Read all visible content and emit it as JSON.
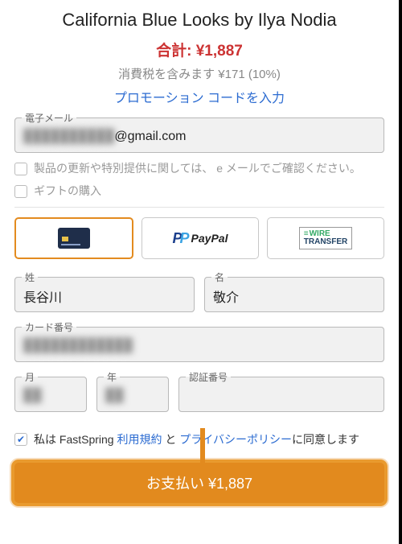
{
  "title": "California Blue Looks by Ilya Nodia",
  "total": {
    "label": "合計:",
    "amount": "¥1,887"
  },
  "tax_line": "消費税を含みます ¥171 (10%)",
  "promo_link": "プロモーション コードを入力",
  "email": {
    "legend": "電子メール",
    "value_masked": "██████████",
    "value_tail": "@gmail.com"
  },
  "opt_updates": {
    "label": "製品の更新や特別提供に関しては、 e メールでご確認ください。",
    "checked": false
  },
  "opt_gift": {
    "label": "ギフトの購入",
    "checked": false
  },
  "payment_methods": {
    "card": {
      "name": "credit-card",
      "selected": true
    },
    "paypal": {
      "label": "PayPal",
      "selected": false
    },
    "wire": {
      "label_top": "WIRE",
      "label_bottom": "TRANSFER",
      "selected": false
    }
  },
  "name": {
    "last": {
      "legend": "姓",
      "value": "長谷川"
    },
    "first": {
      "legend": "名",
      "value": "敬介"
    }
  },
  "card": {
    "number": {
      "legend": "カード番号",
      "value_masked": "████████████"
    },
    "month": {
      "legend": "月",
      "value_masked": "██"
    },
    "year": {
      "legend": "年",
      "value_masked": "██"
    },
    "cvv": {
      "legend": "認証番号",
      "value": ""
    }
  },
  "terms": {
    "checked": true,
    "prefix": "私は FastSpring ",
    "tos": "利用規約",
    "mid": " と ",
    "privacy": "プライバシーポリシー",
    "suffix": "に同意します"
  },
  "pay_button": "お支払い ¥1,887",
  "colors": {
    "accent": "#e28a1e",
    "link": "#2b6bd1",
    "danger": "#c33"
  }
}
